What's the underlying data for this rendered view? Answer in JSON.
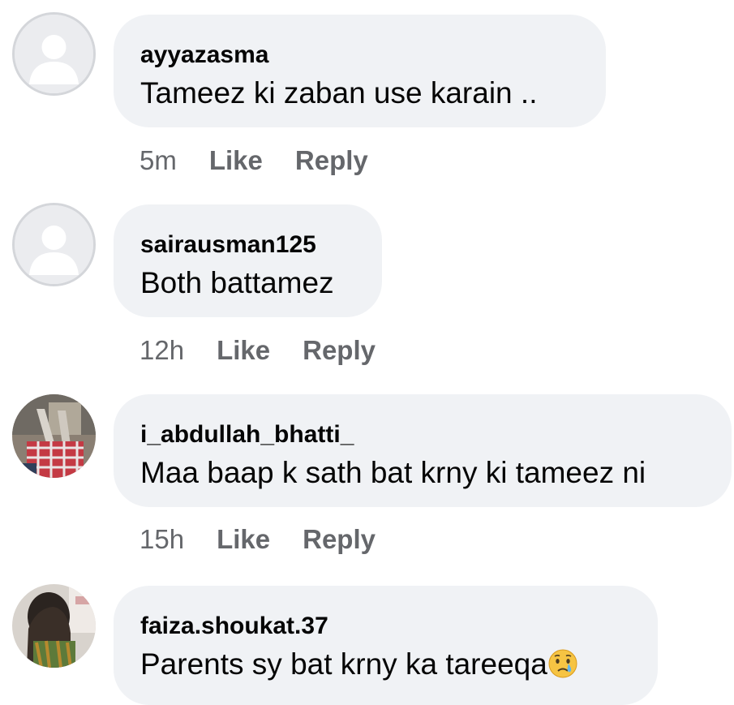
{
  "comments": [
    {
      "username": "ayyazasma",
      "text": "Tameez ki zaban use karain ..",
      "time": "5m",
      "like_label": "Like",
      "reply_label": "Reply",
      "avatar": "default-avatar-icon"
    },
    {
      "username": "sairausman125",
      "text": "Both battamez",
      "time": "12h",
      "like_label": "Like",
      "reply_label": "Reply",
      "avatar": "default-avatar-icon"
    },
    {
      "username": "i_abdullah_bhatti_",
      "text": "Maa baap k sath bat krny ki tameez ni",
      "time": "15h",
      "like_label": "Like",
      "reply_label": "Reply",
      "avatar": "profile-photo"
    },
    {
      "username": "faiza.shoukat.37",
      "text": "Parents sy bat krny ka tareeqa",
      "emoji": "crying-face-emoji",
      "time": "",
      "like_label": "",
      "reply_label": "",
      "avatar": "profile-photo"
    }
  ],
  "colors": {
    "bubble_bg": "#f0f2f5",
    "meta_text": "#65676b",
    "primary_text": "#050505",
    "default_avatar_bg": "#ebecef"
  }
}
